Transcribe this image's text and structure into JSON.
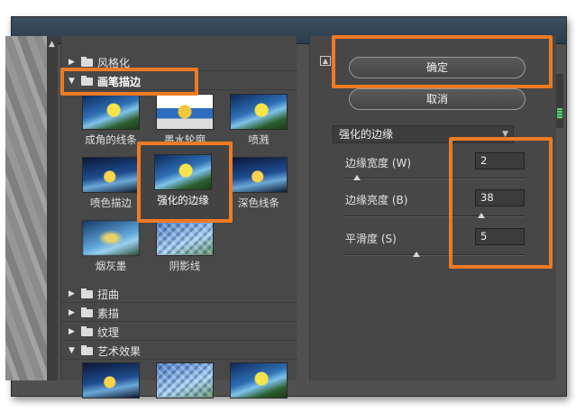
{
  "filter_gallery": {
    "folders_top": [
      {
        "label": "风格化",
        "icon": "folder-icon",
        "expanded": false
      },
      {
        "label": "画笔描边",
        "icon": "folder-icon",
        "expanded": true
      }
    ],
    "thumbnails": [
      {
        "label": "成角的线条"
      },
      {
        "label": "墨水轮廓"
      },
      {
        "label": "喷溅"
      },
      {
        "label": "喷色描边"
      },
      {
        "label": "强化的边缘",
        "selected": true
      },
      {
        "label": "深色线条"
      },
      {
        "label": "烟灰墨"
      },
      {
        "label": "阴影线"
      }
    ],
    "folders_bottom": [
      {
        "label": "扭曲",
        "expanded": false
      },
      {
        "label": "素描",
        "expanded": false
      },
      {
        "label": "纹理",
        "expanded": false
      },
      {
        "label": "艺术效果",
        "expanded": true
      }
    ]
  },
  "buttons": {
    "ok_label": "确定",
    "cancel_label": "取消"
  },
  "settings": {
    "selected_filter": "强化的边缘",
    "params": [
      {
        "label": "边缘宽度 (W)",
        "value": "2",
        "fraction": 0.07
      },
      {
        "label": "边缘亮度 (B)",
        "value": "38",
        "fraction": 0.76
      },
      {
        "label": "平滑度 (S)",
        "value": "5",
        "fraction": 0.4
      }
    ]
  },
  "colors": {
    "highlight": "#ee7a23",
    "panel": "#474747"
  }
}
